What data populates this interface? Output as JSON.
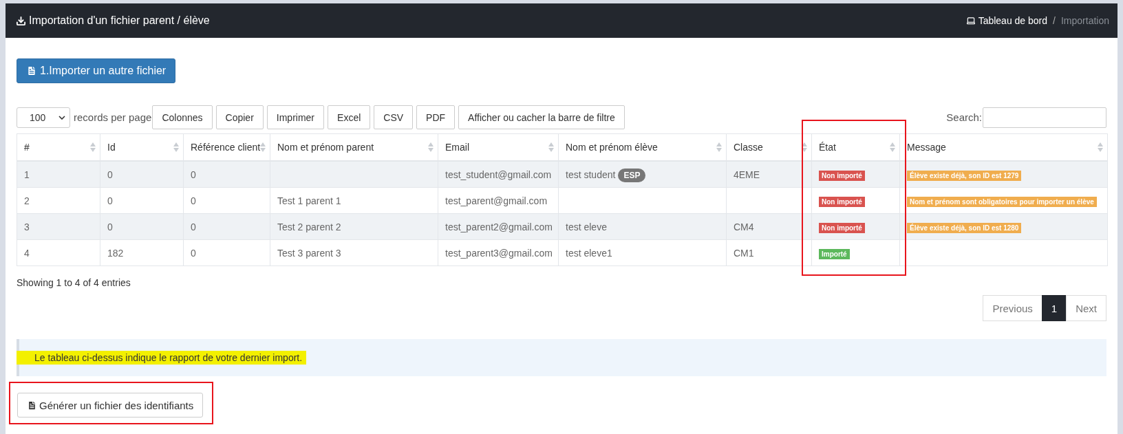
{
  "header": {
    "title": "Importation d'un fichier parent / élève",
    "breadcrumb": [
      {
        "label": "Tableau de bord",
        "selected": false
      },
      {
        "separator": "/",
        "label": "Importation",
        "selected": true
      }
    ]
  },
  "import_button": "1.Importer un autre fichier",
  "toolbar": {
    "page_size": "100",
    "page_size_label": "records per page",
    "buttons": [
      "Colonnes",
      "Copier",
      "Imprimer",
      "Excel",
      "CSV",
      "PDF",
      "Afficher ou cacher la barre de filtre"
    ],
    "search_label": "Search:"
  },
  "table": {
    "columns": [
      {
        "label": "#",
        "annotated": false
      },
      {
        "label": "Id",
        "annotated": false
      },
      {
        "label": "Référence client",
        "annotated": false
      },
      {
        "label": "Nom et prénom parent",
        "annotated": false
      },
      {
        "label": "Email",
        "annotated": false
      },
      {
        "label": "Nom et prénom élève",
        "annotated": false
      },
      {
        "label": "Classe",
        "annotated": false
      },
      {
        "label": "État",
        "annotated": true
      },
      {
        "label": "Message",
        "annotated": false
      }
    ],
    "rows": [
      {
        "num": "1",
        "id": "0",
        "ref": "0",
        "parent": "",
        "email": "test_student@gmail.com",
        "student": "test student",
        "student_tag": "ESP",
        "class": "4EME",
        "state": {
          "kind": "error",
          "label": "Non importé"
        },
        "message": "Élève existe déjà, son ID est 1279"
      },
      {
        "num": "2",
        "id": "0",
        "ref": "0",
        "parent": "Test 1 parent 1",
        "email": "test_parent@gmail.com",
        "student": "",
        "class": "",
        "state": {
          "kind": "error",
          "label": "Non importé"
        },
        "message": "Nom et prénom sont obligatoires pour importer un élève"
      },
      {
        "num": "3",
        "id": "0",
        "ref": "0",
        "parent": "Test 2 parent 2",
        "email": "test_parent2@gmail.com",
        "student": "test eleve",
        "class": "CM4",
        "state": {
          "kind": "error",
          "label": "Non importé"
        },
        "message": "Élève existe déjà, son ID est 1280"
      },
      {
        "num": "4",
        "id": "182",
        "ref": "0",
        "parent": "Test 3 parent 3",
        "email": "test_parent3@gmail.com",
        "student": "test eleve1",
        "class": "CM1",
        "state": {
          "kind": "success",
          "label": "Importé"
        },
        "message": ""
      }
    ]
  },
  "summary": "Showing 1 to 4 of 4 entries",
  "pagination": [
    {
      "label": "Previous",
      "selected": false
    },
    {
      "label": "1",
      "selected": true
    },
    {
      "label": "Next",
      "selected": false
    }
  ],
  "note": {
    "text": "Le tableau ci-dessus indique le rapport de votre dernier import.",
    "highlighted": true
  },
  "generate_button": {
    "label": "Générer un fichier des identifiants",
    "annotated": true
  }
}
